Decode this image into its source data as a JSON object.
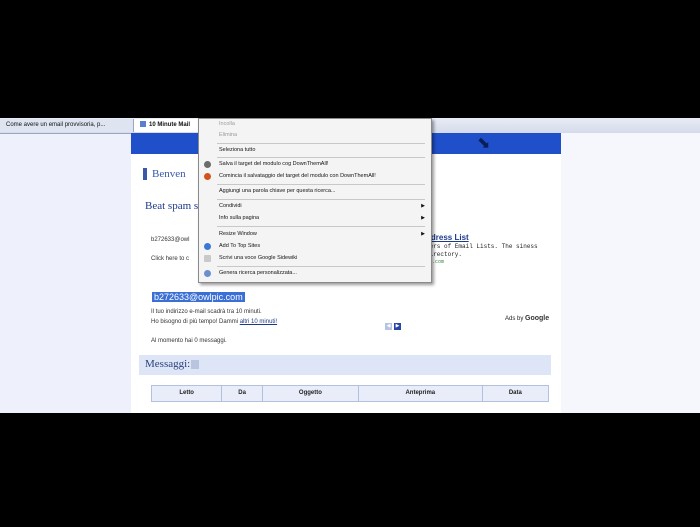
{
  "tabs": [
    {
      "label": "Come avere un email provvisoria, p..."
    },
    {
      "label": "10 Minute Mail"
    }
  ],
  "page": {
    "welcome": "Benven",
    "beat": "Beat spam service.",
    "email_line": "b272633@owl",
    "click_here": "Click here to c",
    "email_selected": "b272633@owlpic.com",
    "expire_line": "Il tuo indirizzo e-mail scadrà tra 10 minuti.",
    "more_time_prefix": "Ho bisogno di più tempo! Dammi ",
    "more_time_link": "altri 10 minuti!",
    "message_count": "Al momento hai 0 messaggi.",
    "messages_title": "Messaggi:"
  },
  "ad": {
    "title": "ddress List",
    "text": "ders of Email Lists. The siness Directory.",
    "url": "se.com",
    "ads_by": "Ads by",
    "google": "Google"
  },
  "table_headers": [
    "Letto",
    "Da",
    "Oggetto",
    "Anteprima",
    "Data"
  ],
  "context_menu": {
    "items": [
      {
        "label": "Incolla",
        "disabled": true
      },
      {
        "label": "Elimina",
        "disabled": true
      },
      {
        "label": "Seleziona tutto",
        "disabled": false
      },
      {
        "label": "Salva il target del modulo cog DownThemAll!",
        "disabled": false
      },
      {
        "label": "Comincia il salvataggio del target del modulo con DownThemAll!",
        "disabled": false
      },
      {
        "label": "Aggiungi una parola chiave per questa ricerca...",
        "disabled": false
      },
      {
        "label": "Condividi",
        "disabled": false
      },
      {
        "label": "Info sulla pagina",
        "disabled": false
      },
      {
        "label": "Resize Window",
        "disabled": false
      },
      {
        "label": "Add To Top Sites",
        "disabled": false
      },
      {
        "label": "Scrivi una voce Google Sidewiki",
        "disabled": false
      },
      {
        "label": "Genera ricerca personalizzata...",
        "disabled": false
      }
    ]
  },
  "colors": {
    "accent": "#1f4fc9",
    "selection": "#3b6fd6"
  }
}
